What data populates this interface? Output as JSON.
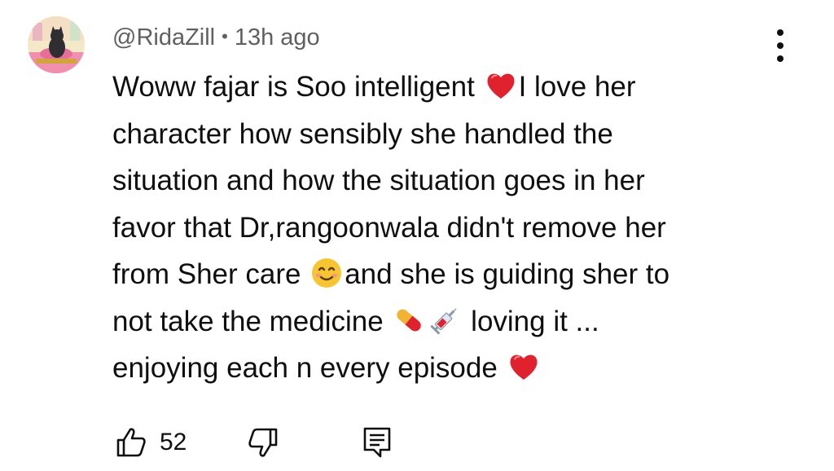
{
  "comment": {
    "author": "@RidaZill",
    "separator": "•",
    "time": "13h ago",
    "body_lines": [
      {
        "text": "Woww fajar is Soo intelligent ",
        "emoji": "red-heart",
        "after": "I love her"
      },
      {
        "text": "character how sensibly she handled the"
      },
      {
        "text": "situation and how the situation goes in her"
      },
      {
        "text": "favor that Dr,rangoonwala didn't remove her"
      },
      {
        "text": "from Sher care ",
        "emoji": "smiling-face",
        "after": "and she is guiding sher to"
      },
      {
        "text": "not take the medicine ",
        "emoji": "pill",
        "emoji2": "syringe",
        "after": " loving it ..."
      },
      {
        "text": "enjoying each n every episode ",
        "emoji": "red-heart"
      }
    ],
    "like_count": "52"
  },
  "icons": {
    "menu": "vertical-dots-icon",
    "like": "thumbs-up-icon",
    "dislike": "thumbs-down-icon",
    "reply": "reply-comment-icon"
  },
  "colors": {
    "text": "#0f0f0f",
    "meta": "#606060",
    "heart": "#e0222f",
    "smiley": "#f7c531"
  }
}
